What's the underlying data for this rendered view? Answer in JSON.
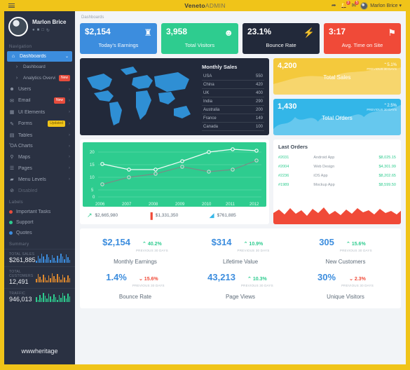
{
  "topbar": {
    "brand_main": "Veneto",
    "brand_sub": "ADMIN",
    "menu_icon": "hamburger-icon",
    "share_icon": "share-icon",
    "bell_icon": "bell-icon",
    "bell_badge": "3",
    "mail_icon": "envelope-icon",
    "mail_badge": "5",
    "user_name": "Marlon Brice ▾"
  },
  "sidebar": {
    "profile_name": "Marlon Brice",
    "profile_icons": [
      "user-icon",
      "briefcase-icon",
      "clock-icon",
      "power-icon"
    ],
    "nav_label": "Navigation",
    "items": [
      {
        "label": "Dashboards",
        "icon": "home-icon",
        "caret": "⌄",
        "active": true
      },
      {
        "label": "Dashboard",
        "icon": "chevron-right-icon",
        "sub": true
      },
      {
        "label": "Analytics Overview",
        "icon": "chevron-right-icon",
        "sub": true,
        "badge": "New",
        "badge_type": "red"
      },
      {
        "label": "Users",
        "icon": "user-icon",
        "caret": "›"
      },
      {
        "label": "Email",
        "icon": "envelope-icon",
        "caret": "›",
        "badge": "New",
        "badge_type": "red"
      },
      {
        "label": "UI Elements",
        "icon": "grid-icon",
        "caret": "›"
      },
      {
        "label": "Forms",
        "icon": "pencil-icon",
        "caret": "›",
        "badge": "Updated",
        "badge_type": "warn"
      },
      {
        "label": "Tables",
        "icon": "table-icon",
        "caret": "›"
      },
      {
        "label": "Charts",
        "icon": "chart-icon",
        "caret": "›"
      },
      {
        "label": "Maps",
        "icon": "pin-icon",
        "caret": "›"
      },
      {
        "label": "Pages",
        "icon": "file-icon",
        "caret": "›"
      },
      {
        "label": "Menu Levels",
        "icon": "folder-icon",
        "caret": "›"
      },
      {
        "label": "Disabled",
        "icon": "ban-icon",
        "disabled": true
      }
    ],
    "labels_title": "Labels",
    "labels": [
      {
        "label": "Important Tasks",
        "color": "#e74c3c"
      },
      {
        "label": "Support",
        "color": "#2ecc8f"
      },
      {
        "label": "Quotes",
        "color": "#3c8dde"
      }
    ],
    "summary_title": "Summary",
    "summary": [
      {
        "key": "TOTAL SALES",
        "value": "$261,885",
        "color": "#3c8dde"
      },
      {
        "key": "TOTAL CUSTOMERS",
        "value": "12,491",
        "color": "#e08a2e"
      },
      {
        "key": "TRAFFIC",
        "value": "946,013",
        "color": "#2ecc8f"
      }
    ],
    "watermark": "wwwheritage"
  },
  "content": {
    "breadcrumb": "Dashboards",
    "stat_cards": [
      {
        "value": "$2,154",
        "label": "Today's Earnings",
        "icon": "trophy-icon",
        "color": "#3c8dde"
      },
      {
        "value": "3,958",
        "label": "Total Visitors",
        "icon": "users-icon",
        "color": "#2ecc8f"
      },
      {
        "value": "23.1%",
        "label": "Bounce Rate",
        "icon": "broken-link-icon",
        "color": "#22293a"
      },
      {
        "value": "3:17",
        "label": "Avg. Time on Site",
        "icon": "tags-icon",
        "color": "#f04a38"
      }
    ],
    "monthly_sales": {
      "title": "Monthly Sales",
      "rows": [
        {
          "country": "USA",
          "value": "550"
        },
        {
          "country": "China",
          "value": "420"
        },
        {
          "country": "UK",
          "value": "400"
        },
        {
          "country": "India",
          "value": "290"
        },
        {
          "country": "Australia",
          "value": "200"
        },
        {
          "country": "France",
          "value": "149"
        },
        {
          "country": "Canada",
          "value": "100"
        }
      ]
    },
    "mini_cards": [
      {
        "value": "4,200",
        "label": "Total Sales",
        "pct": "⌃5.1%",
        "prev": "PREVIOUS 30 DAYS",
        "color": "#f4c93c"
      },
      {
        "value": "1,430",
        "label": "Total Orders",
        "pct": "⌃2.5%",
        "prev": "PREVIOUS 30 DAYS",
        "color": "#33b6e8"
      }
    ],
    "mini_stats": [
      {
        "value": "$2,665,980",
        "icon": "line-chart-icon",
        "color": "#2ecc8f"
      },
      {
        "value": "$1,331,350",
        "icon": "bar-chart-icon",
        "color": "#f04a38"
      },
      {
        "value": "$761,885",
        "icon": "area-chart-icon",
        "color": "#33b6e8"
      }
    ],
    "last_orders": {
      "title": "Last Orders",
      "rows": [
        {
          "id": "#2031",
          "name": "Android App",
          "amount": "$8,025.15"
        },
        {
          "id": "#2004",
          "name": "Web Design",
          "amount": "$4,301.99"
        },
        {
          "id": "#2236",
          "name": "iOS App",
          "amount": "$8,202.65"
        },
        {
          "id": "#1989",
          "name": "Mockup App",
          "amount": "$8,599.50"
        }
      ]
    },
    "kpis": [
      {
        "value": "$2,154",
        "pct": "40.2%",
        "dir": "up",
        "prev": "PREVIOUS 30 DAYS",
        "label": "Monthly Earnings"
      },
      {
        "value": "$314",
        "pct": "10.9%",
        "dir": "up",
        "prev": "PREVIOUS 30 DAYS",
        "label": "Lifetime Value"
      },
      {
        "value": "305",
        "pct": "15.6%",
        "dir": "up",
        "prev": "PREVIOUS 30 DAYS",
        "label": "New Customers"
      },
      {
        "value": "1.4%",
        "pct": "15.6%",
        "dir": "down",
        "prev": "PREVIOUS 30 DAYS",
        "label": "Bounce Rate"
      },
      {
        "value": "43,213",
        "pct": "10.3%",
        "dir": "up",
        "prev": "PREVIOUS 30 DAYS",
        "label": "Page Views"
      },
      {
        "value": "30%",
        "pct": "2.3%",
        "dir": "down",
        "prev": "PREVIOUS 30 DAYS",
        "label": "Unique Visitors"
      }
    ]
  },
  "chart_data": [
    {
      "type": "line",
      "title": "",
      "x": [
        "2006",
        "2007",
        "2008",
        "2009",
        "2010",
        "2011",
        "2012"
      ],
      "series": [
        {
          "name": "series-light",
          "values": [
            13,
            10.8,
            10.8,
            14,
            18,
            20,
            19.5
          ]
        },
        {
          "name": "series-dark",
          "values": [
            5,
            8,
            9.2,
            12,
            10,
            10.8,
            14
          ]
        }
      ],
      "ylim": [
        0,
        22
      ],
      "yticks": [
        0,
        5,
        10,
        15,
        20
      ],
      "grid": true,
      "legend": "none"
    },
    {
      "type": "table",
      "title": "Monthly Sales",
      "categories": [
        "USA",
        "China",
        "UK",
        "India",
        "Australia",
        "France",
        "Canada"
      ],
      "values": [
        550,
        420,
        400,
        290,
        200,
        149,
        100
      ]
    },
    {
      "type": "area",
      "title": "Total Sales",
      "values": [
        8,
        9,
        11,
        10,
        12,
        11,
        10,
        12,
        13,
        12,
        11,
        13,
        15,
        14,
        16
      ],
      "ylim": [
        0,
        20
      ]
    },
    {
      "type": "area",
      "title": "Total Orders",
      "values": [
        6,
        10,
        7,
        12,
        8,
        14,
        9,
        13,
        7,
        11,
        9,
        14,
        12,
        16,
        18
      ],
      "ylim": [
        0,
        20
      ]
    },
    {
      "type": "area",
      "title": "Last Orders Trend",
      "values": [
        9,
        12,
        8,
        14,
        10,
        13,
        9,
        15,
        11,
        12,
        8,
        13,
        10,
        14,
        11,
        15,
        9,
        12
      ],
      "ylim": [
        0,
        20
      ]
    }
  ]
}
